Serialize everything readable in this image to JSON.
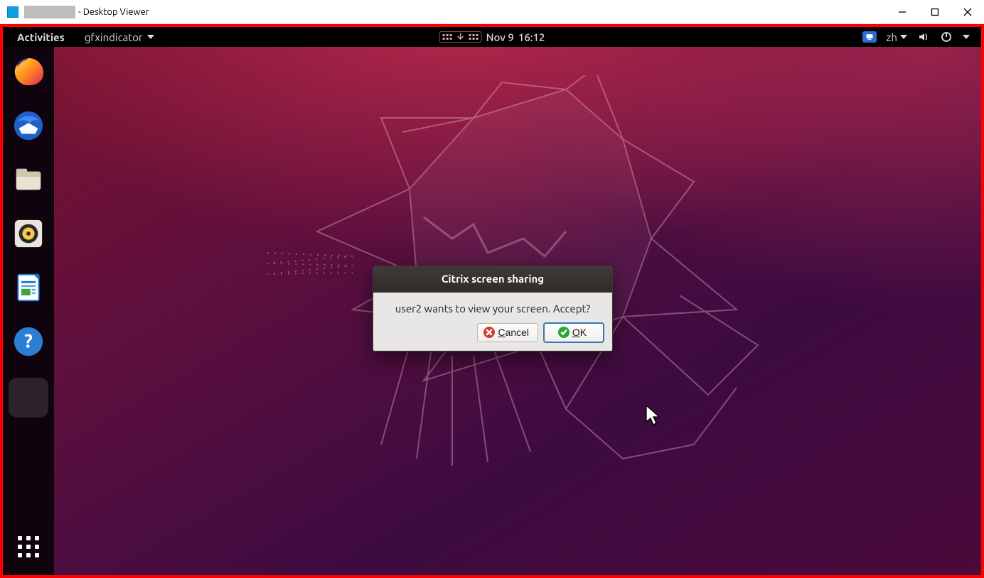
{
  "host_window": {
    "title_suffix": " - Desktop Viewer"
  },
  "gnome_top": {
    "activities": "Activities",
    "app_menu": "gfxindicator",
    "date": "Nov 9",
    "time": "16:12",
    "lang": "zh"
  },
  "dialog": {
    "title": "Citrix screen sharing",
    "message": "user2 wants to view your screen. Accept?",
    "cancel": "Cancel",
    "ok": "OK"
  },
  "dock": {
    "items": [
      {
        "name": "firefox"
      },
      {
        "name": "thunderbird"
      },
      {
        "name": "files"
      },
      {
        "name": "rhythmbox"
      },
      {
        "name": "libreoffice-writer"
      },
      {
        "name": "help"
      }
    ]
  }
}
